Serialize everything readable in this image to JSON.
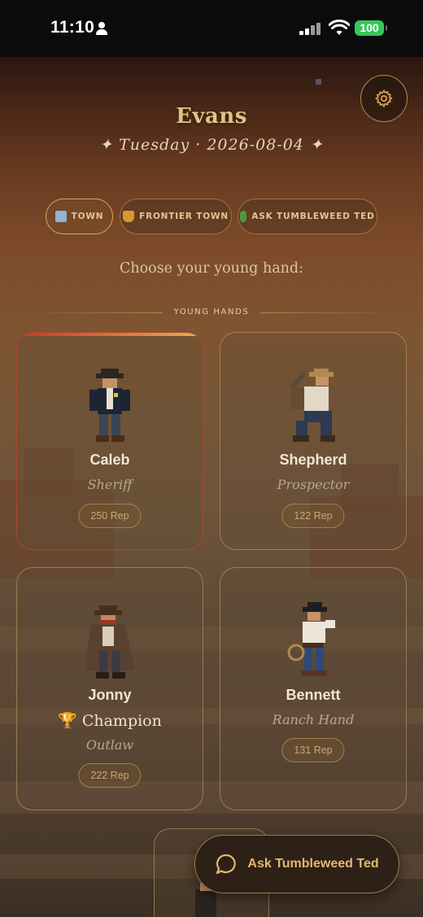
{
  "status_bar": {
    "time": "11:10",
    "battery": "100"
  },
  "header": {
    "title": "Evans",
    "subtitle": "✦ Tuesday · 2026-08-04 ✦",
    "settings_icon": "gear-icon"
  },
  "chips": [
    {
      "label": "TOWN",
      "icon": "town-icon",
      "active": true
    },
    {
      "label": "FRONTIER TOWN",
      "icon": "trophy-icon",
      "active": false
    },
    {
      "label": "ASK TUMBLEWEED TED",
      "icon": "cactus-icon",
      "active": false
    }
  ],
  "prompt": "Choose your young hand:",
  "section_label": "YOUNG HANDS",
  "hands": [
    {
      "name": "Caleb",
      "role": "Sheriff",
      "rep": "250 Rep",
      "selected": true
    },
    {
      "name": "Shepherd",
      "role": "Prospector",
      "rep": "122 Rep",
      "selected": false
    },
    {
      "name": "Jonny",
      "badge": "🏆 Champion",
      "role": "Outlaw",
      "rep": "222 Rep",
      "selected": false
    },
    {
      "name": "Bennett",
      "role": "Ranch Hand",
      "rep": "131 Rep",
      "selected": false
    }
  ],
  "ask_button": {
    "label": "Ask Tumbleweed Ted",
    "icon": "chat-bubble-icon"
  },
  "colors": {
    "accent": "#e3c184",
    "selected_border": "#b0442a",
    "battery": "#35c759"
  }
}
